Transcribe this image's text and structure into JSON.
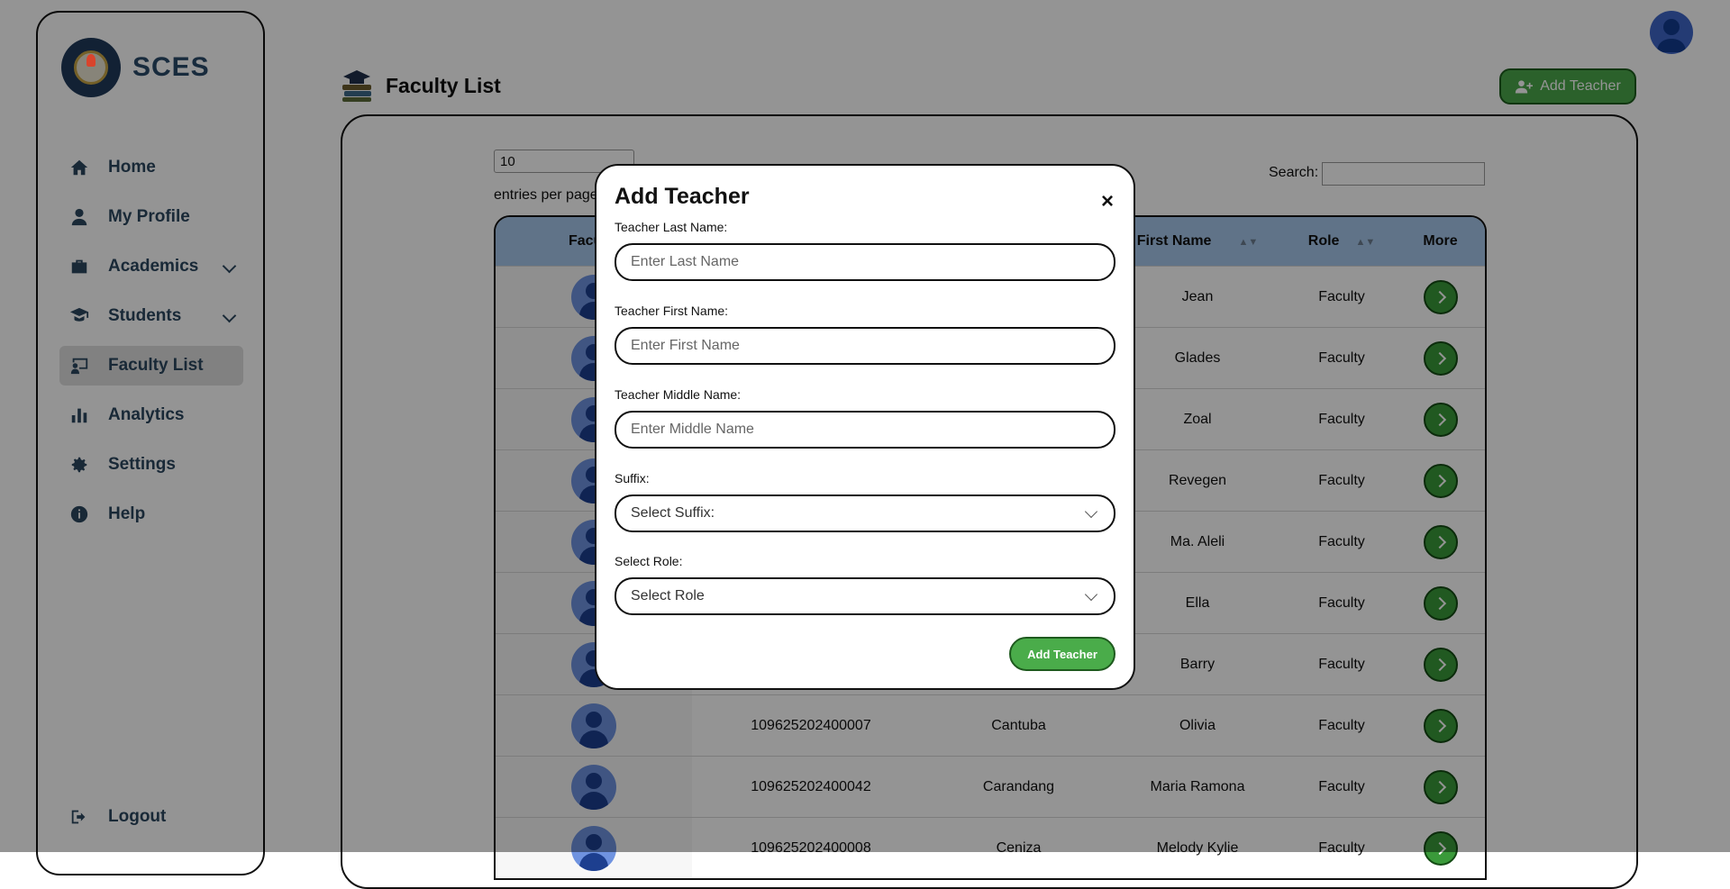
{
  "brand": {
    "name": "SCES",
    "logo_icon": "school-seal-logo"
  },
  "sidebar": {
    "items": [
      {
        "label": "Home",
        "icon": "home-icon"
      },
      {
        "label": "My Profile",
        "icon": "user-icon"
      },
      {
        "label": "Academics",
        "icon": "briefcase-icon",
        "expandable": true
      },
      {
        "label": "Students",
        "icon": "graduate-icon",
        "expandable": true
      },
      {
        "label": "Faculty List",
        "icon": "chalkboard-teacher-icon",
        "active": true
      },
      {
        "label": "Analytics",
        "icon": "bar-chart-icon"
      },
      {
        "label": "Settings",
        "icon": "gear-icon"
      },
      {
        "label": "Help",
        "icon": "info-icon"
      }
    ],
    "logout_label": "Logout"
  },
  "header": {
    "title": "Faculty List",
    "add_button_label": "Add Teacher"
  },
  "table_controls": {
    "per_page_value": "10",
    "per_page_label": "entries per page",
    "search_label": "Search:"
  },
  "table": {
    "columns": [
      "Faculty",
      "",
      "",
      "First Name",
      "Role",
      "More"
    ],
    "rows": [
      {
        "id": "",
        "last": "",
        "first": "Jean",
        "role": "Faculty"
      },
      {
        "id": "",
        "last": "",
        "first": "Glades",
        "role": "Faculty"
      },
      {
        "id": "",
        "last": "",
        "first": "Zoal",
        "role": "Faculty"
      },
      {
        "id": "",
        "last": "",
        "first": "Revegen",
        "role": "Faculty"
      },
      {
        "id": "",
        "last": "",
        "first": "Ma. Aleli",
        "role": "Faculty"
      },
      {
        "id": "",
        "last": "",
        "first": "Ella",
        "role": "Faculty"
      },
      {
        "id": "",
        "last": "",
        "first": "Barry",
        "role": "Faculty"
      },
      {
        "id": "109625202400007",
        "last": "Cantuba",
        "first": "Olivia",
        "role": "Faculty"
      },
      {
        "id": "109625202400042",
        "last": "Carandang",
        "first": "Maria Ramona",
        "role": "Faculty"
      },
      {
        "id": "109625202400008",
        "last": "Ceniza",
        "first": "Melody Kylie",
        "role": "Faculty"
      }
    ]
  },
  "modal": {
    "title": "Add Teacher",
    "close_glyph": "×",
    "last_name_label": "Teacher Last Name:",
    "last_name_placeholder": "Enter Last Name",
    "first_name_label": "Teacher First Name:",
    "first_name_placeholder": "Enter First Name",
    "middle_name_label": "Teacher Middle Name:",
    "middle_name_placeholder": "Enter Middle Name",
    "suffix_label": "Suffix:",
    "suffix_value": "Select Suffix:",
    "role_label": "Select Role:",
    "role_value": "Select Role",
    "submit_label": "Add Teacher"
  }
}
